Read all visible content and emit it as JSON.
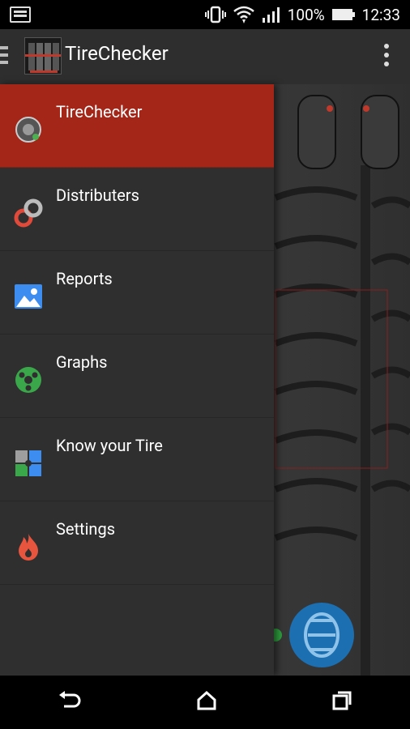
{
  "status_bar": {
    "battery": "100%",
    "time": "12:33"
  },
  "app_bar": {
    "title": "TireChecker"
  },
  "drawer": {
    "items": [
      {
        "label": "TireChecker",
        "icon": "tire-icon",
        "active": true
      },
      {
        "label": "Distributers",
        "icon": "chain-link-icon",
        "active": false
      },
      {
        "label": "Reports",
        "icon": "image-icon",
        "active": false
      },
      {
        "label": "Graphs",
        "icon": "steering-wheel-icon",
        "active": false
      },
      {
        "label": "Know your Tire",
        "icon": "puzzle-icon",
        "active": false
      },
      {
        "label": "Settings",
        "icon": "flame-icon",
        "active": false
      }
    ]
  },
  "colors": {
    "accent": "#a32618",
    "drawer_bg": "#2f2f2f",
    "app_bar_bg": "#2e2e2e"
  }
}
